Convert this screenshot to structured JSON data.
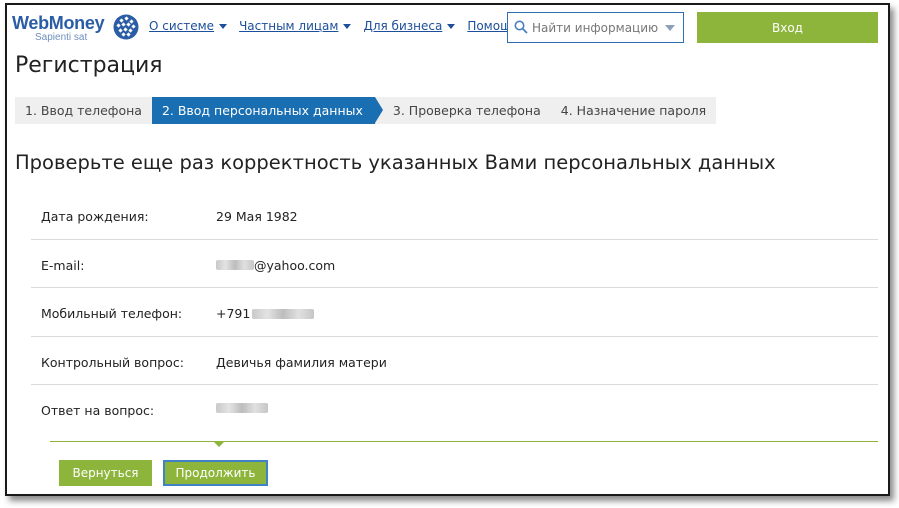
{
  "header": {
    "logo_title": "WebMoney",
    "logo_sub": "Sapienti sat",
    "nav": [
      {
        "label": "О системе"
      },
      {
        "label": "Частным лицам"
      },
      {
        "label": "Для бизнеса"
      },
      {
        "label": "Помощь"
      }
    ],
    "search_placeholder": "Найти информацию",
    "login_label": "Вход"
  },
  "page": {
    "title": "Регистрация",
    "subtitle": "Проверьте еще раз корректность указанных Вами персональных данных"
  },
  "steps": [
    {
      "label": "1. Ввод телефона",
      "active": false
    },
    {
      "label": "2. Ввод персональных данных",
      "active": true
    },
    {
      "label": "3. Проверка телефона",
      "active": false
    },
    {
      "label": "4. Назначение пароля",
      "active": false
    }
  ],
  "details": [
    {
      "label": "Дата рождения:",
      "value": "29 Мая 1982"
    },
    {
      "label": "E-mail:",
      "value": "@yahoo.com"
    },
    {
      "label": "Мобильный телефон:",
      "value": "+791"
    },
    {
      "label": "Контрольный вопрос:",
      "value": "Девичья фамилия матери"
    },
    {
      "label": "Ответ на вопрос:",
      "value": ""
    }
  ],
  "actions": {
    "back_label": "Вернуться",
    "continue_label": "Продолжить"
  },
  "colors": {
    "accent_green": "#8db53b",
    "step_active": "#1a6fb2",
    "link_blue": "#1d4f9a"
  }
}
